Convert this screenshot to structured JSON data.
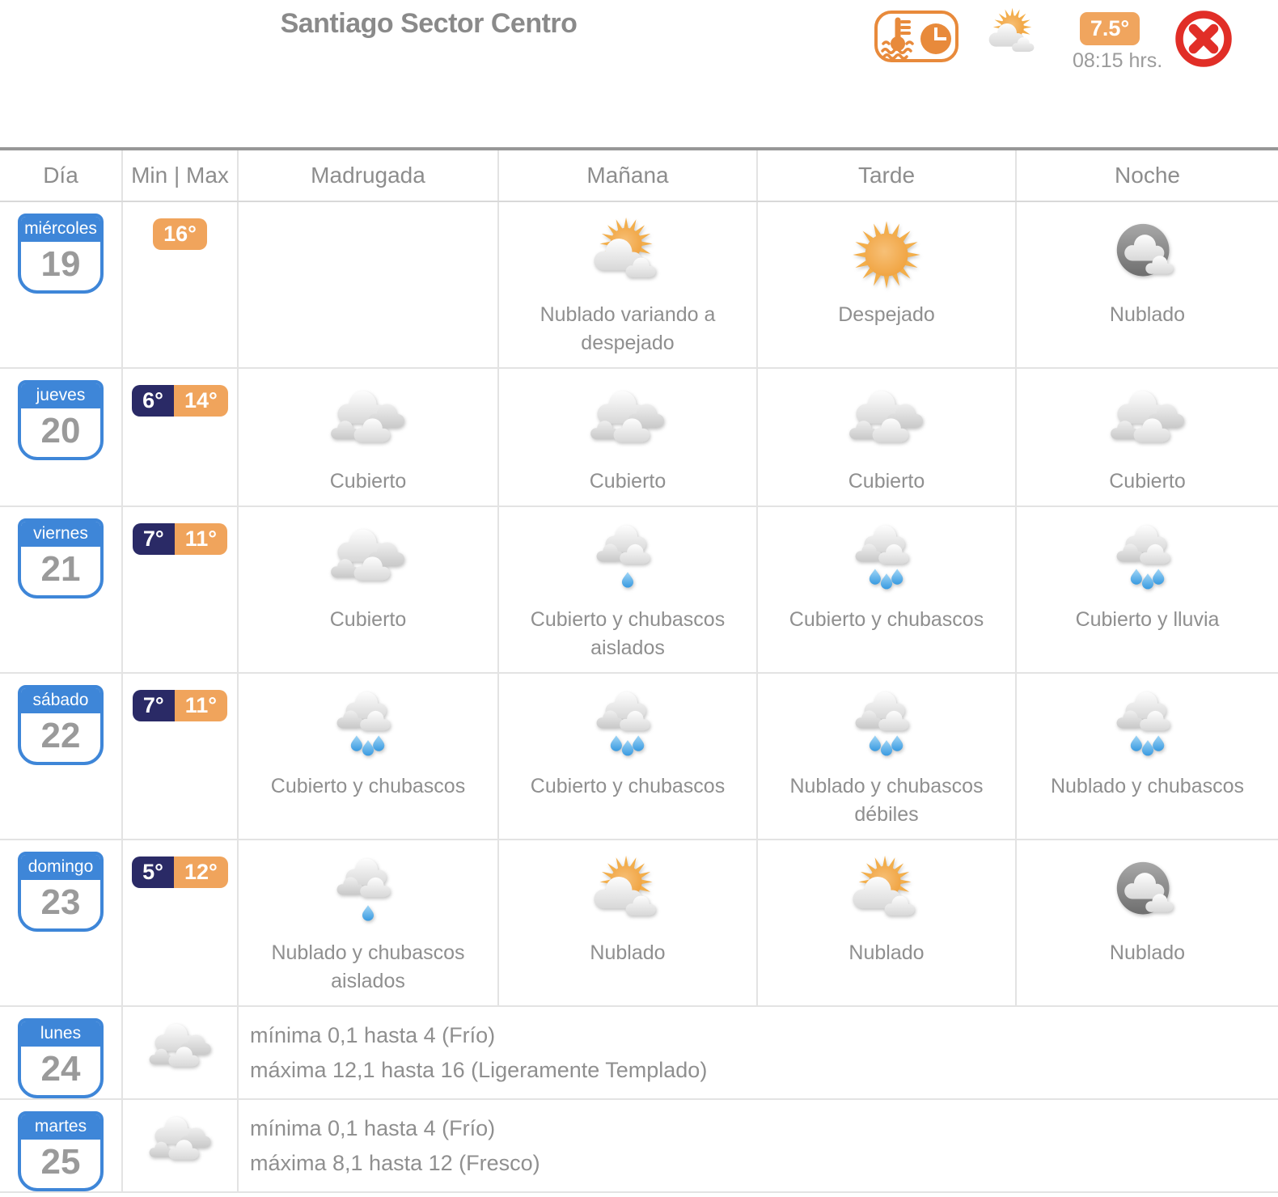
{
  "header": {
    "title": "Santiago Sector Centro",
    "current_temp": "7.5°",
    "current_time": "08:15 hrs.",
    "condition_icon": "sun-clouds",
    "temp_time_icon": "thermometer-clock",
    "close_icon": "close"
  },
  "colors": {
    "calendar_blue": "#3e86d8",
    "badge_navy": "#2a2a66",
    "badge_orange": "#f0a45c",
    "icon_orange": "#e88a3b",
    "close_red": "#e12e27",
    "text_gray": "#8f8f8f",
    "rain_blue": "#4aa5e8"
  },
  "table": {
    "columns": [
      "Día",
      "Min | Max",
      "Madrugada",
      "Mañana",
      "Tarde",
      "Noche"
    ],
    "rows": [
      {
        "day_name": "miércoles",
        "day_number": "19",
        "min": null,
        "max": "16°",
        "periods": [
          {
            "icon": null,
            "label": null
          },
          {
            "icon": "sun-clouds",
            "label": "Nublado variando a despejado"
          },
          {
            "icon": "sun",
            "label": "Despejado"
          },
          {
            "icon": "night-clouds",
            "label": "Nublado"
          }
        ]
      },
      {
        "day_name": "jueves",
        "day_number": "20",
        "min": "6°",
        "max": "14°",
        "periods": [
          {
            "icon": "clouds",
            "label": "Cubierto"
          },
          {
            "icon": "clouds",
            "label": "Cubierto"
          },
          {
            "icon": "clouds",
            "label": "Cubierto"
          },
          {
            "icon": "clouds",
            "label": "Cubierto"
          }
        ]
      },
      {
        "day_name": "viernes",
        "day_number": "21",
        "min": "7°",
        "max": "11°",
        "periods": [
          {
            "icon": "clouds",
            "label": "Cubierto"
          },
          {
            "icon": "clouds-rain-1",
            "label": "Cubierto y chubascos aislados"
          },
          {
            "icon": "clouds-rain-3",
            "label": "Cubierto y chubascos"
          },
          {
            "icon": "clouds-rain-3",
            "label": "Cubierto y lluvia"
          }
        ]
      },
      {
        "day_name": "sábado",
        "day_number": "22",
        "min": "7°",
        "max": "11°",
        "periods": [
          {
            "icon": "clouds-rain-3",
            "label": "Cubierto y chubascos"
          },
          {
            "icon": "clouds-rain-3",
            "label": "Cubierto y chubascos"
          },
          {
            "icon": "clouds-rain-3",
            "label": "Nublado y chubascos débiles"
          },
          {
            "icon": "clouds-rain-3",
            "label": "Nublado y chubascos"
          }
        ]
      },
      {
        "day_name": "domingo",
        "day_number": "23",
        "min": "5°",
        "max": "12°",
        "periods": [
          {
            "icon": "clouds-rain-1",
            "label": "Nublado y chubascos aislados"
          },
          {
            "icon": "sun-clouds",
            "label": "Nublado"
          },
          {
            "icon": "sun-clouds",
            "label": "Nublado"
          },
          {
            "icon": "night-clouds",
            "label": "Nublado"
          }
        ]
      },
      {
        "day_name": "lunes",
        "day_number": "24",
        "icon": "clouds",
        "summary": [
          "mínima 0,1 hasta 4 (Frío)",
          "máxima 12,1 hasta 16 (Ligeramente Templado)"
        ]
      },
      {
        "day_name": "martes",
        "day_number": "25",
        "icon": "clouds",
        "summary": [
          "mínima 0,1 hasta 4 (Frío)",
          "máxima 8,1 hasta 12 (Fresco)"
        ]
      }
    ]
  }
}
